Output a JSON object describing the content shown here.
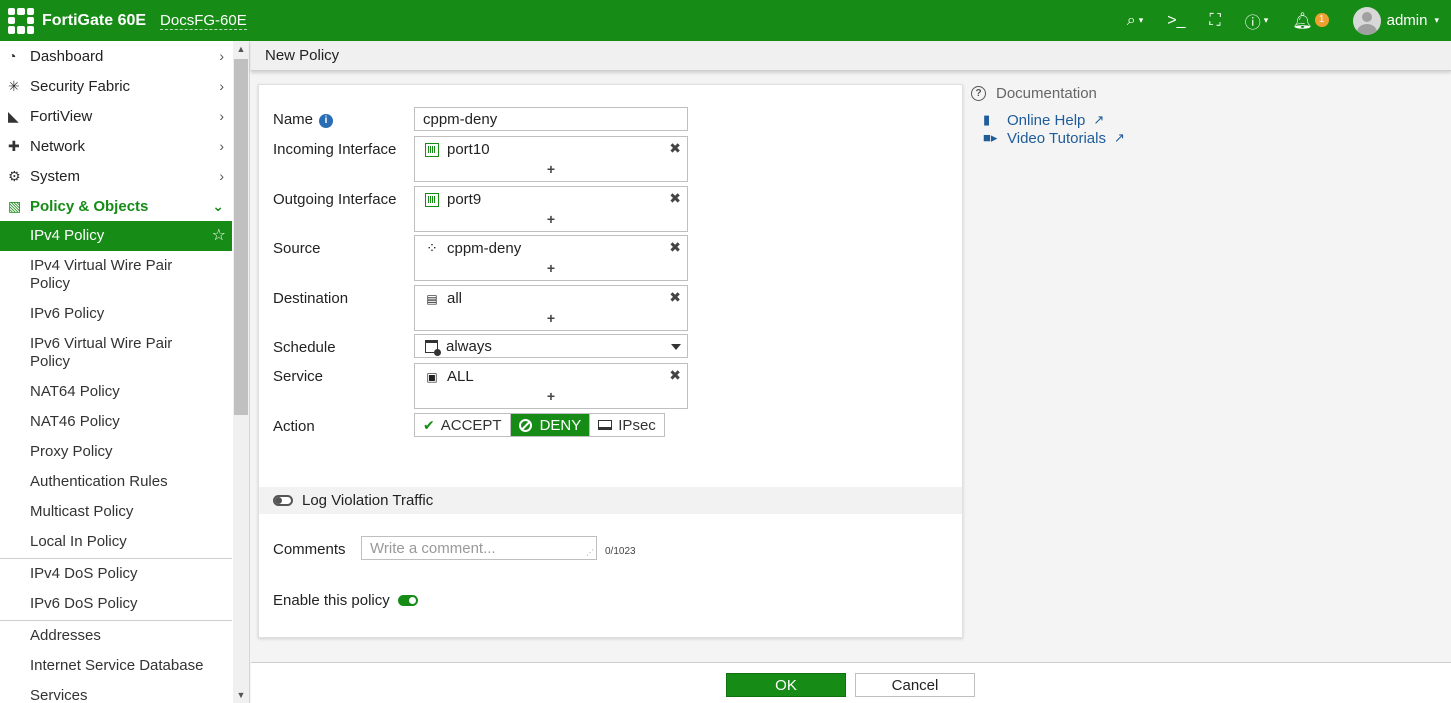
{
  "topbar": {
    "app_title": "FortiGate 60E",
    "device_name": "DocsFG-60E",
    "notification_count": "1",
    "user_name": "admin",
    "icons": [
      "search-icon",
      "cli-console-icon",
      "fullscreen-icon",
      "help-icon",
      "bell-icon"
    ]
  },
  "sidebar": {
    "items": [
      {
        "label": "Dashboard",
        "icon": "dashboard-icon"
      },
      {
        "label": "Security Fabric",
        "icon": "security-fabric-icon"
      },
      {
        "label": "FortiView",
        "icon": "fortiview-icon"
      },
      {
        "label": "Network",
        "icon": "network-icon"
      },
      {
        "label": "System",
        "icon": "gear-icon"
      },
      {
        "label": "Policy & Objects",
        "icon": "policy-icon"
      }
    ],
    "sub_items": [
      "IPv4 Policy",
      "IPv4 Virtual Wire Pair Policy",
      "IPv6 Policy",
      "IPv6 Virtual Wire Pair Policy",
      "NAT64 Policy",
      "NAT46 Policy",
      "Proxy Policy",
      "Authentication Rules",
      "Multicast Policy",
      "Local In Policy",
      "IPv4 DoS Policy",
      "IPv6 DoS Policy",
      "Addresses",
      "Internet Service Database",
      "Services"
    ]
  },
  "page": {
    "title": "New Policy"
  },
  "form": {
    "name_label": "Name",
    "name_value": "cppm-deny",
    "incoming_label": "Incoming Interface",
    "incoming_value": "port10",
    "outgoing_label": "Outgoing Interface",
    "outgoing_value": "port9",
    "source_label": "Source",
    "source_value": "cppm-deny",
    "destination_label": "Destination",
    "destination_value": "all",
    "schedule_label": "Schedule",
    "schedule_value": "always",
    "service_label": "Service",
    "service_value": "ALL",
    "action_label": "Action",
    "action_options": [
      "ACCEPT",
      "DENY",
      "IPsec"
    ],
    "action_selected": "DENY",
    "log_violation_label": "Log Violation Traffic",
    "log_violation_enabled": false,
    "comments_label": "Comments",
    "comments_placeholder": "Write a comment...",
    "comments_count": "0/1023",
    "enable_label": "Enable this policy",
    "enable_policy": true
  },
  "documentation": {
    "title": "Documentation",
    "links": [
      "Online Help",
      "Video Tutorials"
    ]
  },
  "footer": {
    "ok_label": "OK",
    "cancel_label": "Cancel"
  },
  "colors": {
    "brand_green": "#168c16",
    "link_blue": "#1f5c99",
    "badge_orange": "#f0a030"
  }
}
